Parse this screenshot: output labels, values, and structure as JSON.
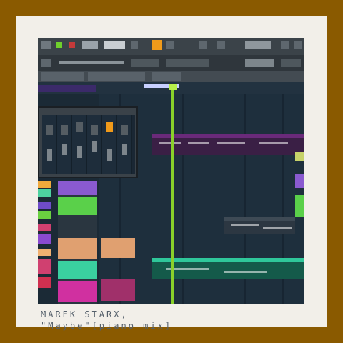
{
  "colors": {
    "border": "#8a5a00",
    "mat": "#f2efe9",
    "daw_background": "#1b2a36",
    "playhead": "#8ad12a",
    "accent_orange": "#f09a1a"
  },
  "caption": {
    "artist": "MAREK STARX,",
    "title": "\"Maybe\"[piano mix]"
  },
  "icons": [
    "play-icon",
    "record-icon",
    "pattern-icon",
    "mixer-icon"
  ]
}
